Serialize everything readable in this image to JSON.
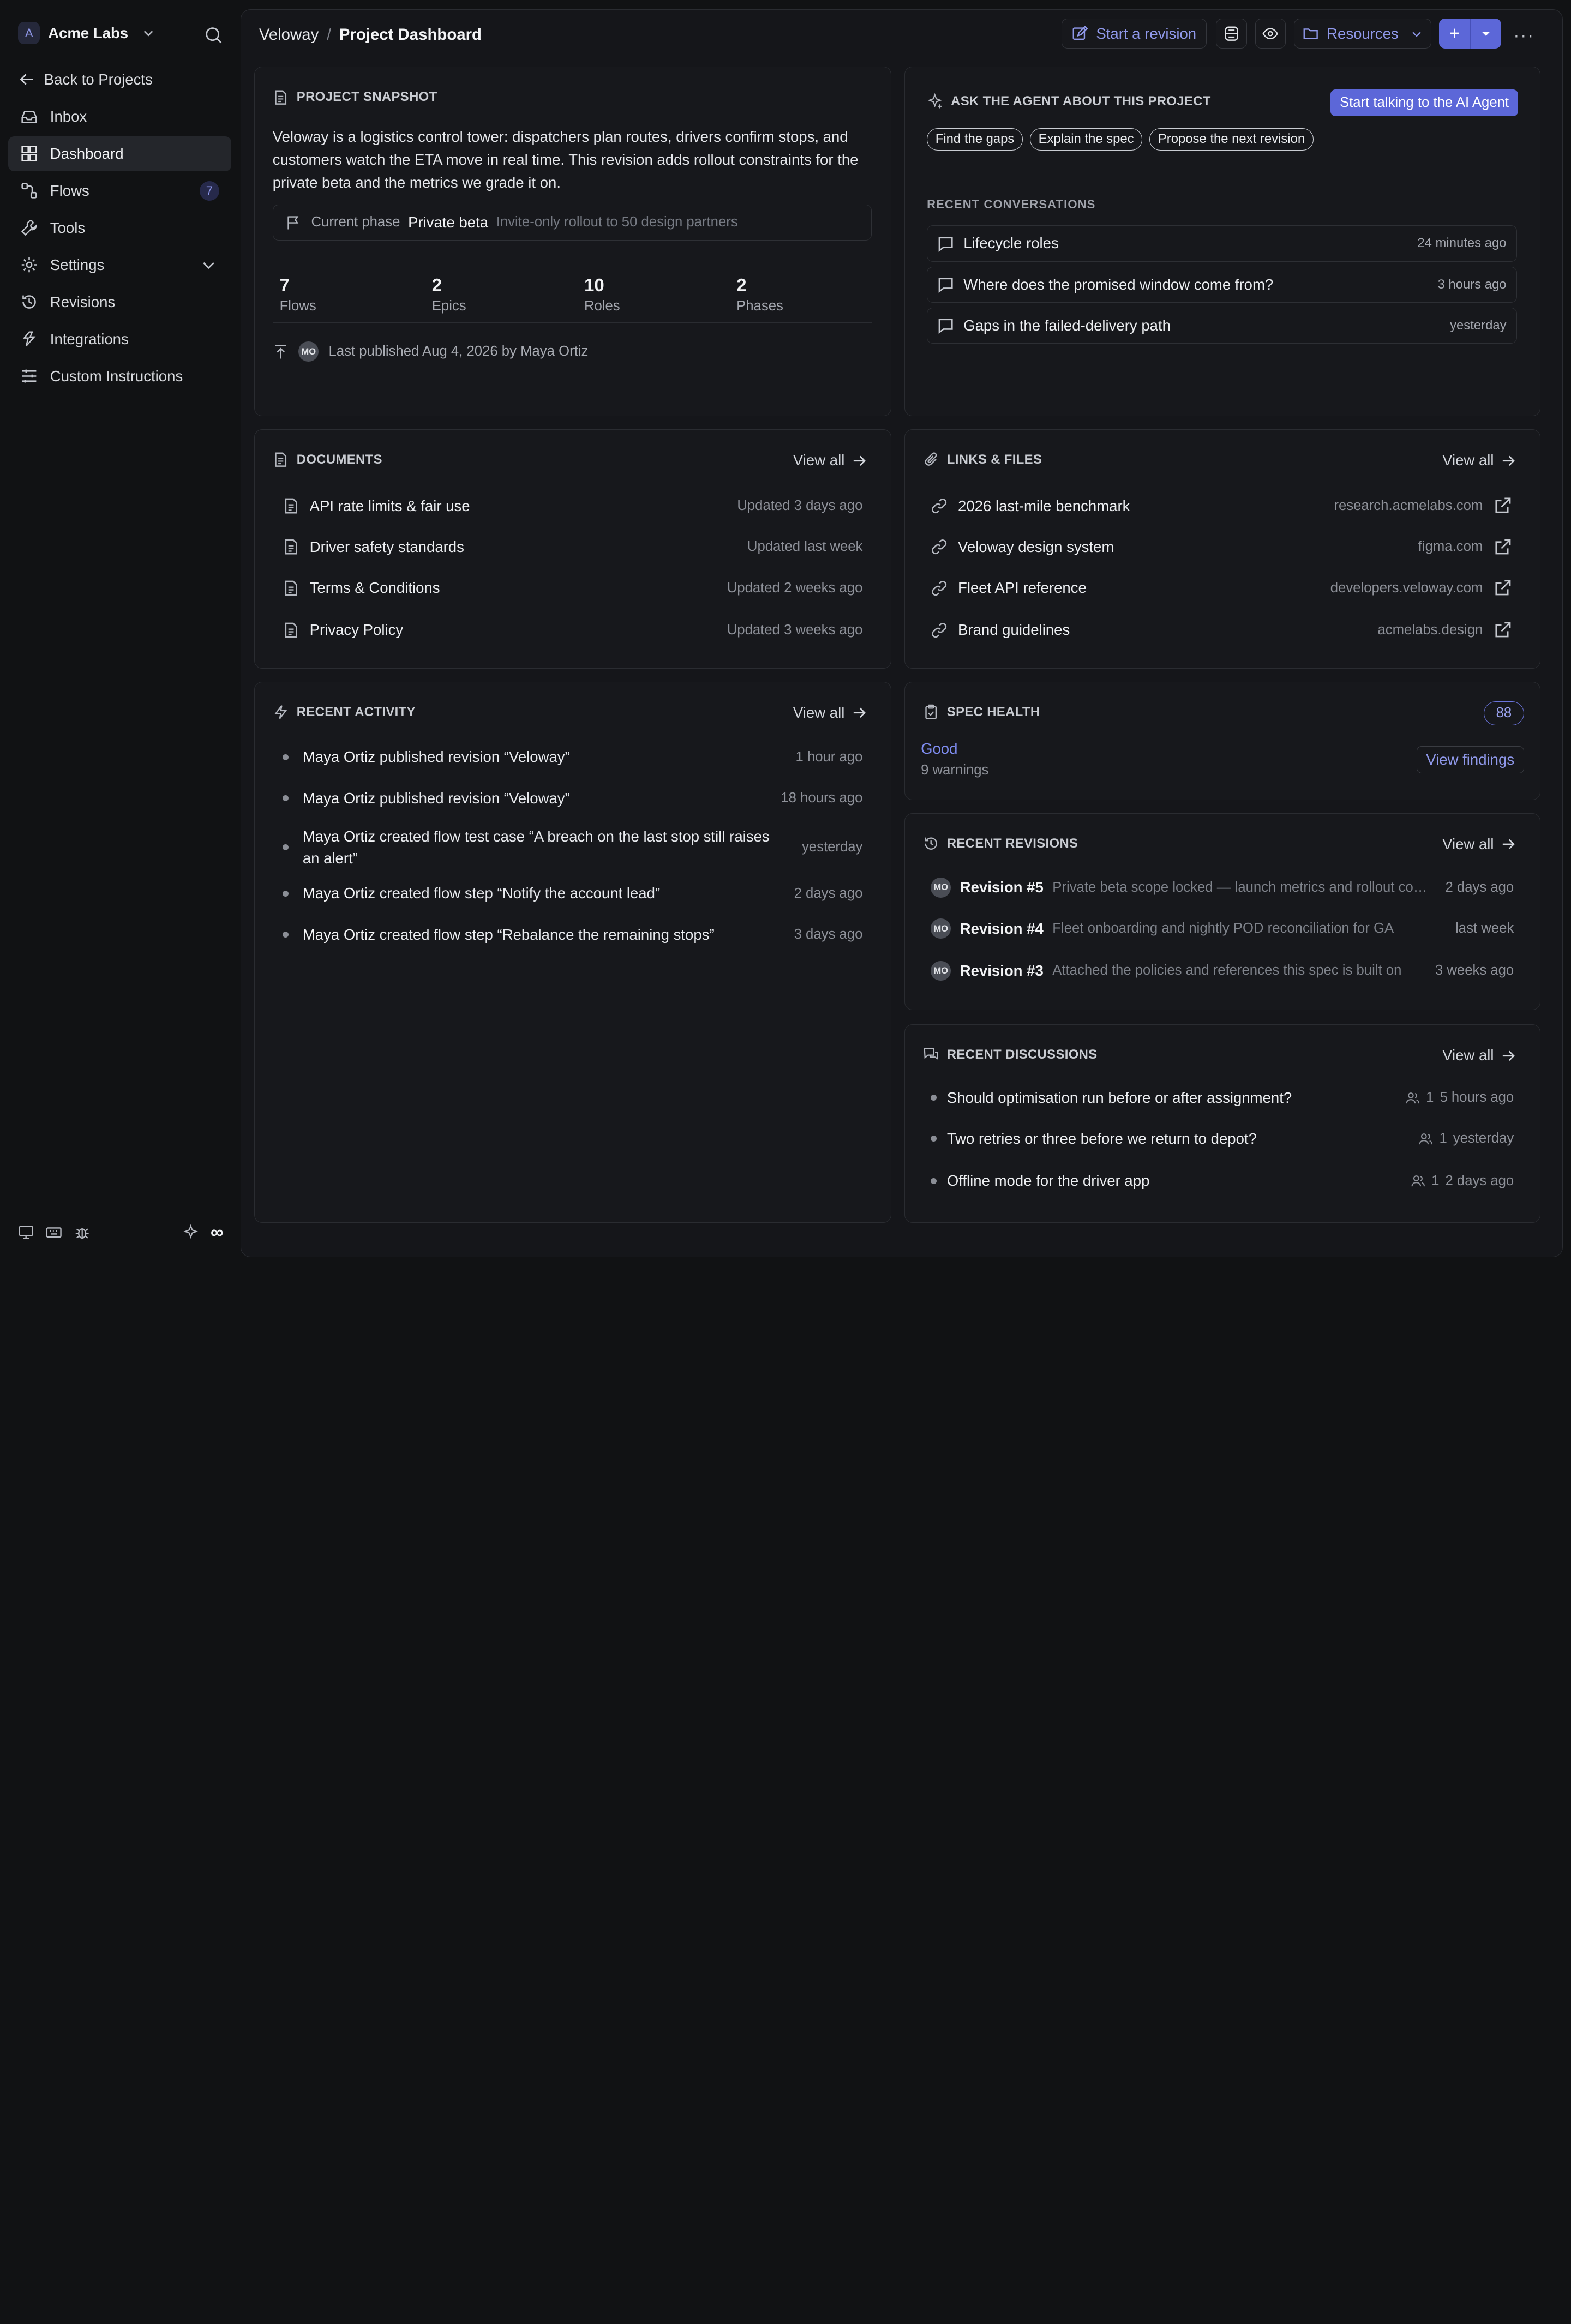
{
  "org": {
    "initial": "A",
    "name": "Acme Labs"
  },
  "sidebar": {
    "back": "Back to Projects",
    "items": [
      {
        "label": "Inbox",
        "icon": "inbox-icon"
      },
      {
        "label": "Dashboard",
        "icon": "dashboard-icon",
        "active": true
      },
      {
        "label": "Flows",
        "icon": "flows-icon",
        "badge": "7"
      },
      {
        "label": "Tools",
        "icon": "wrench-icon"
      },
      {
        "label": "Settings",
        "icon": "gear-icon"
      },
      {
        "label": "Revisions",
        "icon": "history-icon"
      },
      {
        "label": "Integrations",
        "icon": "integrations-icon"
      },
      {
        "label": "Custom Instructions",
        "icon": "sliders-icon"
      }
    ],
    "bottom_right": "∞"
  },
  "breadcrumb": {
    "project": "Veloway",
    "separator": "/",
    "page": "Project Dashboard"
  },
  "toolbar": {
    "revision": "Start a revision",
    "resources": "Resources",
    "plus": "+",
    "more": "···"
  },
  "snapshot": {
    "title": "Project Snapshot",
    "description": "Veloway is a logistics control tower: dispatchers plan routes, drivers confirm stops, and customers watch the ETA move in real time. This revision adds rollout constraints for the private beta and the metrics we grade it on.",
    "phase_label": "Current phase",
    "phase_value": "Private beta",
    "phase_desc": "Invite-only rollout to 50 design partners",
    "stats": [
      {
        "n": "7",
        "l": "Flows"
      },
      {
        "n": "2",
        "l": "Epics"
      },
      {
        "n": "10",
        "l": "Roles"
      },
      {
        "n": "2",
        "l": "Phases"
      }
    ],
    "avatar": "MO",
    "published": "Last published Aug 4, 2026 by Maya Ortiz"
  },
  "agent": {
    "title": "Ask the agent about this project",
    "button": "Start talking to the AI Agent",
    "chips": [
      "Find the gaps",
      "Explain the spec",
      "Propose the next revision"
    ],
    "recent_label": "Recent conversations",
    "conversations": [
      {
        "title": "Lifecycle roles",
        "time": "24 minutes ago"
      },
      {
        "title": "Where does the promised window come from?",
        "time": "3 hours ago"
      },
      {
        "title": "Gaps in the failed-delivery path",
        "time": "yesterday"
      }
    ]
  },
  "documents": {
    "title": "Documents",
    "view_all": "View all",
    "items": [
      {
        "name": "API rate limits & fair use",
        "meta": "Updated 3 days ago"
      },
      {
        "name": "Driver safety standards",
        "meta": "Updated last week"
      },
      {
        "name": "Terms & Conditions",
        "meta": "Updated 2 weeks ago"
      },
      {
        "name": "Privacy Policy",
        "meta": "Updated 3 weeks ago"
      }
    ]
  },
  "links": {
    "title": "Links & Files",
    "view_all": "View all",
    "items": [
      {
        "name": "2026 last-mile benchmark",
        "domain": "research.acmelabs.com"
      },
      {
        "name": "Veloway design system",
        "domain": "figma.com"
      },
      {
        "name": "Fleet API reference",
        "domain": "developers.veloway.com"
      },
      {
        "name": "Brand guidelines",
        "domain": "acmelabs.design"
      }
    ]
  },
  "activity": {
    "title": "Recent Activity",
    "view_all": "View all",
    "items": [
      {
        "who": "Maya Ortiz",
        "text": " published revision “Veloway”",
        "time": "1 hour ago"
      },
      {
        "who": "Maya Ortiz",
        "text": " published revision “Veloway”",
        "time": "18 hours ago"
      },
      {
        "who": "Maya Ortiz",
        "text": " created flow test case “A breach on the last stop still raises an alert”",
        "time": "yesterday"
      },
      {
        "who": "Maya Ortiz",
        "text": " created flow step “Notify the account lead”",
        "time": "2 days ago"
      },
      {
        "who": "Maya Ortiz",
        "text": " created flow step “Rebalance the remaining stops”",
        "time": "3 days ago"
      }
    ]
  },
  "health": {
    "title": "Spec Health",
    "score": "88",
    "status": "Good",
    "warnings": "9 warnings",
    "button": "View findings"
  },
  "revisions": {
    "title": "Recent Revisions",
    "view_all": "View all",
    "items": [
      {
        "avatar": "MO",
        "name": "Revision #5",
        "desc": "Private beta scope locked — launch metrics and rollout constraints",
        "time": "2 days ago"
      },
      {
        "avatar": "MO",
        "name": "Revision #4",
        "desc": "Fleet onboarding and nightly POD reconciliation for GA",
        "time": "last week"
      },
      {
        "avatar": "MO",
        "name": "Revision #3",
        "desc": "Attached the policies and references this spec is built on",
        "time": "3 weeks ago"
      }
    ]
  },
  "discussions": {
    "title": "Recent Discussions",
    "view_all": "View all",
    "items": [
      {
        "title": "Should optimisation run before or after assignment?",
        "count": "1",
        "time": "5 hours ago"
      },
      {
        "title": "Two retries or three before we return to depot?",
        "count": "1",
        "time": "yesterday"
      },
      {
        "title": "Offline mode for the driver app",
        "count": "1",
        "time": "2 days ago"
      }
    ]
  }
}
